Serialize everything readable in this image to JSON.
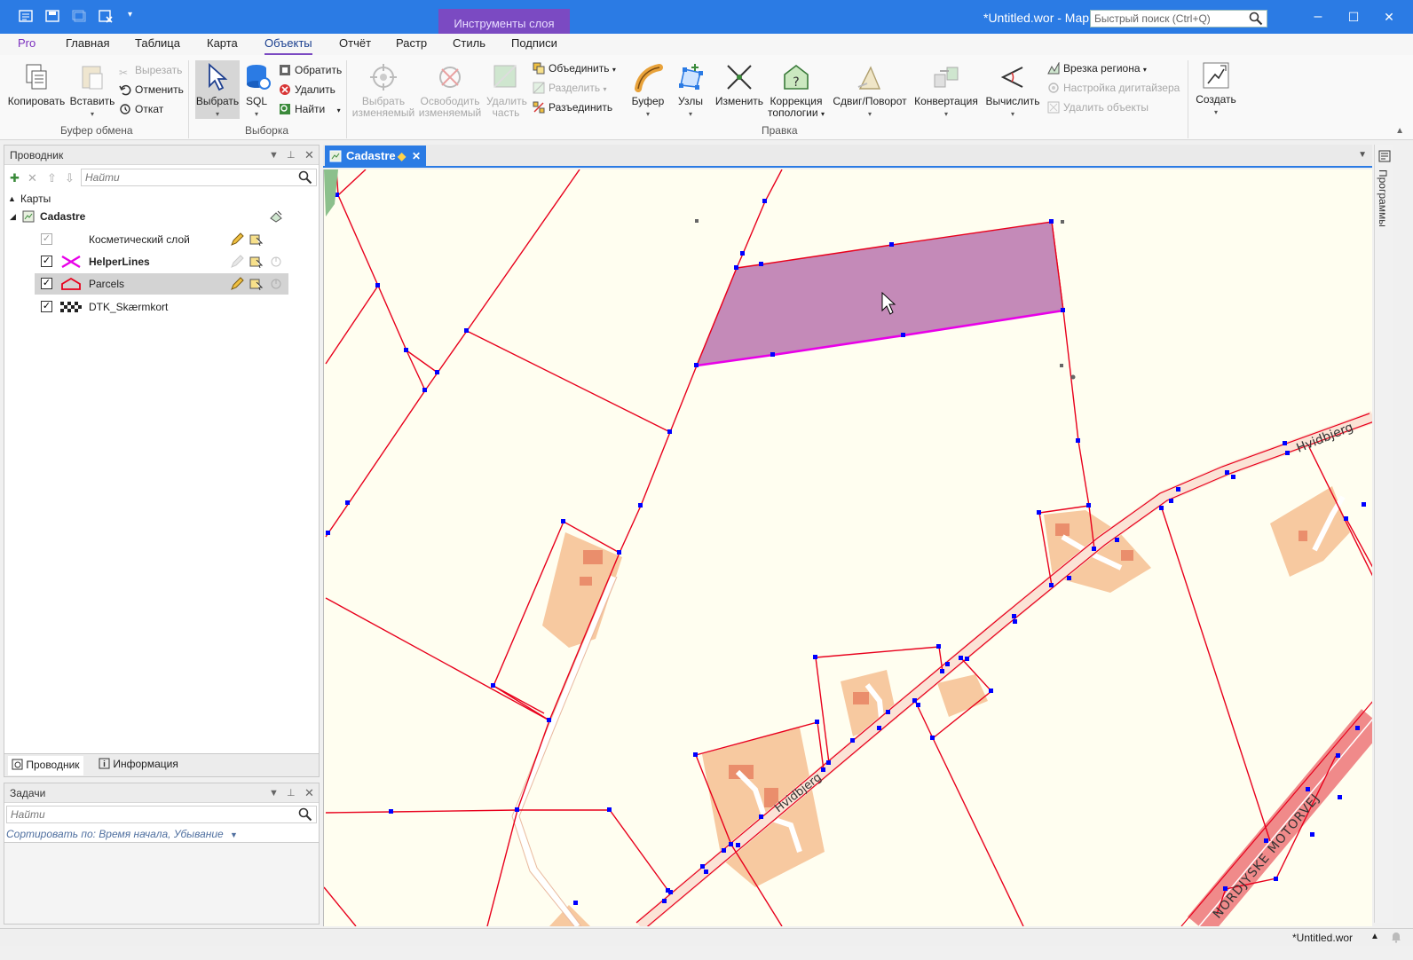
{
  "titlebar": {
    "title": "*Untitled.wor - MapInfo Pro",
    "context_group": "Инструменты слоя",
    "quick_search_placeholder": "Быстрый поиск (Ctrl+Q)",
    "window_minimize": "–",
    "window_maximize": "☐",
    "window_close": "✕"
  },
  "ribbon_tabs": [
    "Pro",
    "Главная",
    "Таблица",
    "Карта",
    "Объекты",
    "Отчёт",
    "Растр",
    "Стиль",
    "Подписи"
  ],
  "active_tab": "Объекты",
  "ribbon": {
    "clipboard": {
      "copy": "Копировать",
      "paste": "Вставить",
      "cut": "Вырезать",
      "undo": "Отменить",
      "rollback": "Откат",
      "group_label": "Буфер обмена"
    },
    "selection": {
      "select": "Выбрать",
      "sql": "SQL",
      "invert": "Обратить",
      "delete": "Удалить",
      "find": "Найти",
      "group_label": "Выборка"
    },
    "edit": {
      "select_editable_1": "Выбрать",
      "select_editable_2": "изменяемый",
      "release_editable_1": "Освободить",
      "release_editable_2": "изменяемый",
      "delete_part_1": "Удалить",
      "delete_part_2": "часть",
      "combine": "Объединить",
      "split": "Разделить",
      "disaggregate": "Разъединить",
      "buffer": "Буфер",
      "nodes": "Узлы",
      "modify": "Изменить",
      "topology_1": "Коррекция",
      "topology_2": "топологии",
      "shift_rotate": "Сдвиг/Поворот",
      "convert": "Конвертация",
      "calculate": "Вычислить",
      "region_inset": "Врезка региона",
      "digitizer_setup": "Настройка дигитайзера",
      "delete_objects": "Удалить объекты",
      "group_label": "Правка"
    },
    "create": {
      "create": "Создать"
    }
  },
  "explorer": {
    "title": "Проводник",
    "find_placeholder": "Найти",
    "maps_label": "Карты",
    "map_name": "Cadastre",
    "layers": [
      {
        "name": "Косметический слой",
        "checked": true,
        "bold": false
      },
      {
        "name": "HelperLines",
        "checked": true,
        "bold": true
      },
      {
        "name": "Parcels",
        "checked": true,
        "bold": false
      },
      {
        "name": "DTK_Skærmkort",
        "checked": true,
        "bold": false
      }
    ],
    "check_mark": "✓",
    "bottom_tabs": [
      "Проводник",
      "Информация"
    ]
  },
  "tasks": {
    "title": "Задачи",
    "find_placeholder": "Найти",
    "sort_label": "Сортировать по: Время начала, Убывание"
  },
  "map_window": {
    "tab_title": "Cadastre",
    "modified_marker": "◆",
    "close": "✕",
    "road_labels": [
      "Hvidbjerg",
      "Hvidbjerg",
      "NORDJYSKE MOTORVEJ"
    ]
  },
  "right_strip": {
    "label": "Программы"
  },
  "statusbar": {
    "workspace": "*Untitled.wor"
  },
  "colors": {
    "titlebar": "#2b7be4",
    "context_group": "#7b4ac2",
    "map_background": "#fffef0",
    "parcel_lines": "#e8001c",
    "selected_parcel": "#c48ab8",
    "selected_edge": "#e800e8",
    "vertex": "#0000ff",
    "buildings": "#f7c9a0",
    "motorway": "#f08a8a"
  }
}
